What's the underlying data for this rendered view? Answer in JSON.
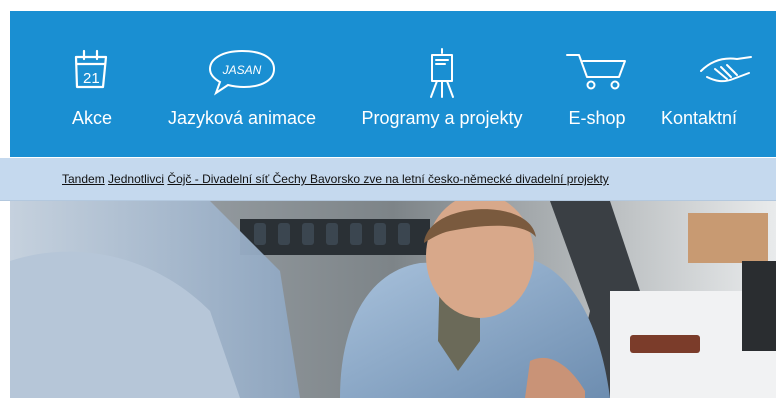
{
  "nav": {
    "items": [
      {
        "label": "Akce",
        "icon": "calendar-icon",
        "icon_text": "21"
      },
      {
        "label": "Jazyková animace",
        "icon": "speech-bubble-icon",
        "icon_text": "JASAN"
      },
      {
        "label": "Programy a projekty",
        "icon": "flipchart-icon"
      },
      {
        "label": "E-shop",
        "icon": "shopping-cart-icon"
      },
      {
        "label": "Kontaktní",
        "icon": "handshake-icon"
      }
    ]
  },
  "breadcrumb": {
    "items": [
      "Tandem",
      "Jednotlivci",
      "Čojč - Divadelní síť Čechy Bavorsko zve na letní česko-německé divadelní projekty"
    ]
  },
  "colors": {
    "nav_background": "#1a8fd2",
    "breadcrumb_background": "#c5d9ee",
    "nav_text": "#ffffff"
  }
}
